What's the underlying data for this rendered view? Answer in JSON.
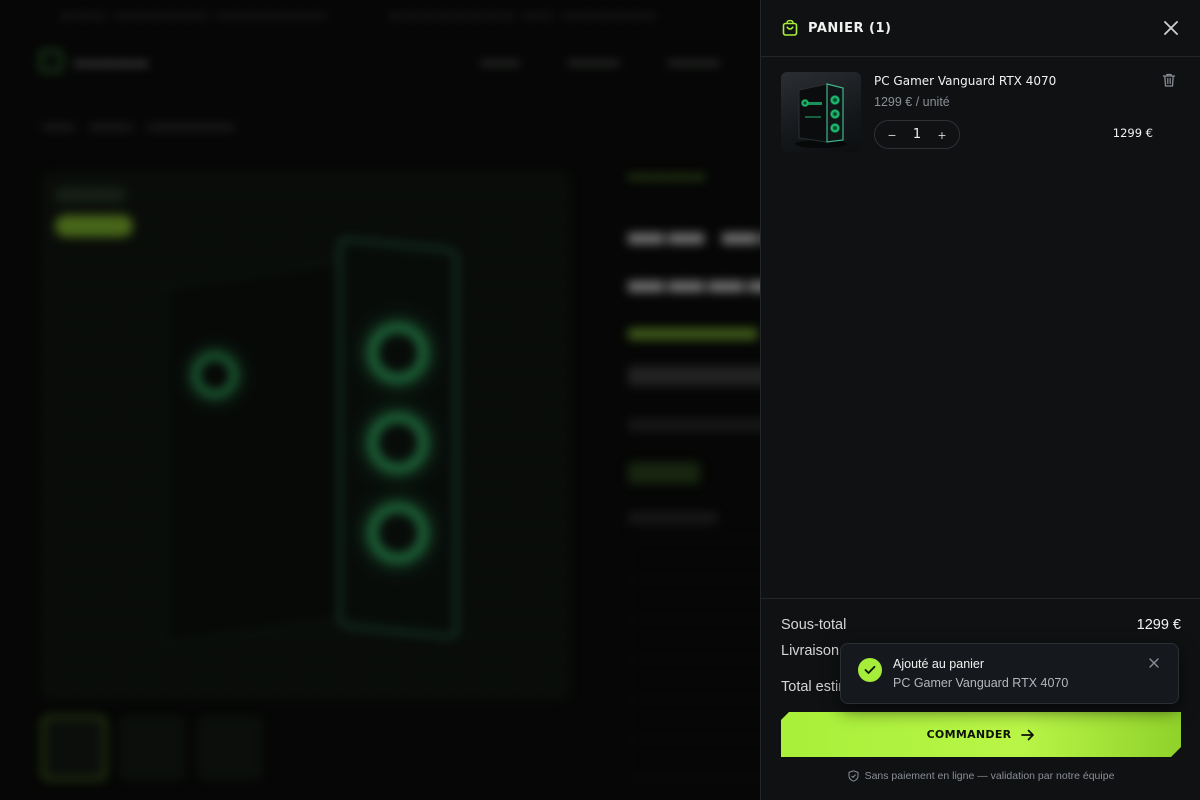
{
  "colors": {
    "accent": "#a8f03a",
    "drawer_bg": "#0f1113",
    "toast_bg": "#15181c"
  },
  "cart": {
    "title": "PANIER (1)",
    "items": [
      {
        "name": "PC Gamer Vanguard RTX 4070",
        "unit_price": "1299 € / unité",
        "quantity": "1",
        "decrement": "−",
        "increment": "+",
        "line_total": "1299 €",
        "icon_remove": "trash-icon"
      }
    ],
    "summary": {
      "subtotal_label": "Sous-total",
      "subtotal_value": "1299 €",
      "shipping_label": "Livraison",
      "total_label": "Total estimé"
    },
    "checkout_label": "COMMANDER",
    "note": "Sans paiement en ligne — validation par notre équipe"
  },
  "toast": {
    "title": "Ajouté au panier",
    "message": "PC Gamer Vanguard RTX 4070"
  }
}
